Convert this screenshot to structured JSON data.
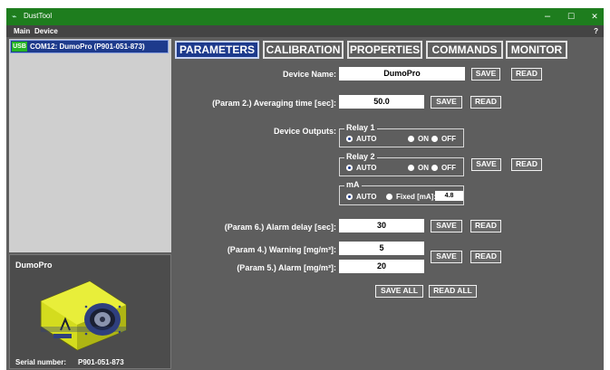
{
  "window": {
    "title": "DustTool",
    "controls": {
      "minimize": "–",
      "maximize": "☐",
      "close": "✕"
    }
  },
  "menu": {
    "items": [
      "Main",
      "Device"
    ],
    "help": "?"
  },
  "device_list": {
    "badge": "USB",
    "entry": "COM12: DumoPro (P901-051-873)"
  },
  "info_panel": {
    "title": "DumoPro",
    "serial_label": "Serial number:",
    "serial_value": "P901-051-873"
  },
  "tabs": [
    "PARAMETERS",
    "CALIBRATION",
    "PROPERTIES",
    "COMMANDS",
    "MONITOR"
  ],
  "active_tab": "PARAMETERS",
  "form": {
    "device_name": {
      "label": "Device Name:",
      "value": "DumoPro"
    },
    "averaging_time": {
      "label": "(Param 2.) Averaging time [sec]:",
      "value": "50.0"
    },
    "device_outputs_label": "Device Outputs:",
    "relay1": {
      "title": "Relay 1",
      "options": [
        "AUTO",
        "ON",
        "OFF"
      ],
      "selected": "AUTO"
    },
    "relay2": {
      "title": "Relay 2",
      "options": [
        "AUTO",
        "ON",
        "OFF"
      ],
      "selected": "AUTO"
    },
    "ma": {
      "title": "mA",
      "auto": "AUTO",
      "fixed": "Fixed [mA]:",
      "fixed_value": "4.8",
      "selected": "AUTO"
    },
    "alarm_delay": {
      "label": "(Param 6.) Alarm delay [sec]:",
      "value": "30"
    },
    "warning": {
      "label": "(Param 4.) Warning [mg/m³]:",
      "value": "5"
    },
    "alarm": {
      "label": "(Param 5.) Alarm [mg/m³]:",
      "value": "20"
    }
  },
  "buttons": {
    "save": "SAVE",
    "read": "READ",
    "save_all": "SAVE ALL",
    "read_all": "READ ALL"
  },
  "colors": {
    "titlebar": "#1e7d1e",
    "background": "#5e5e5e",
    "active_tab": "#1d3a8c",
    "device_body": "#d9e021"
  }
}
